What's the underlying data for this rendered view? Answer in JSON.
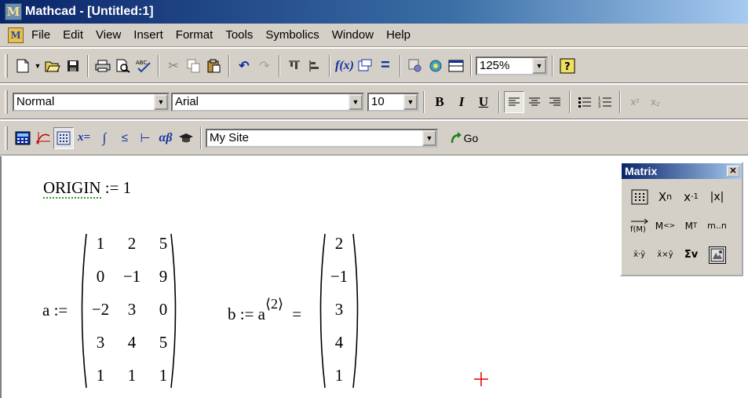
{
  "window": {
    "title": "Mathcad - [Untitled:1]"
  },
  "menu": [
    "File",
    "Edit",
    "View",
    "Insert",
    "Format",
    "Tools",
    "Symbolics",
    "Window",
    "Help"
  ],
  "toolbar_standard": {
    "zoom": "125%"
  },
  "toolbar_formatting": {
    "style": "Normal",
    "font": "Arial",
    "size": "10"
  },
  "toolbar_math": {
    "site": "My Site",
    "go_label": "Go"
  },
  "palette": {
    "title": "Matrix",
    "close": "✕",
    "buttons": [
      "[:::]",
      "Xn",
      "x⁻¹",
      "|x|",
      "f(M)",
      "M⟨⟩",
      "Mᵀ",
      "m..n",
      "x·y",
      "x×y",
      "Σv",
      "grid"
    ]
  },
  "worksheet": {
    "origin_var": "ORIGIN",
    "origin_rest": ":= 1",
    "a_label": "a :=",
    "a_matrix": [
      [
        "1",
        "2",
        "5"
      ],
      [
        "0",
        "−1",
        "9"
      ],
      [
        "−2",
        "3",
        "0"
      ],
      [
        "3",
        "4",
        "5"
      ],
      [
        "1",
        "1",
        "1"
      ]
    ],
    "b_label": "b := a",
    "b_sup": "⟨2⟩",
    "equals": "=",
    "b_vector": [
      "2",
      "−1",
      "3",
      "4",
      "1"
    ]
  }
}
